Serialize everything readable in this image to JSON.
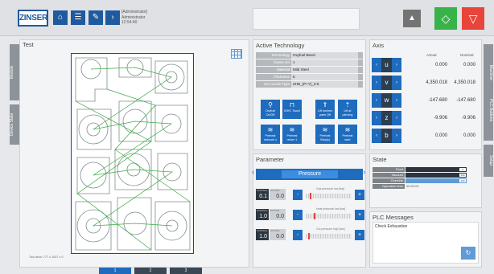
{
  "header": {
    "logo": "ZINSER",
    "user_role": "[Administrator]",
    "user_name": "Administrator",
    "time": "12:54:40",
    "icons": [
      "home-icon",
      "list-icon",
      "wrench-icon",
      "chevron-right-icon"
    ],
    "colors": {
      "accent": "#1f5a9e",
      "start": "#37b34a",
      "stop": "#e8443a"
    }
  },
  "left_tabs": [
    "Module",
    "Device State"
  ],
  "right_tabs": [
    "Machine",
    "PLC Buttons",
    "Setup"
  ],
  "test_panel": {
    "title": "Test",
    "footer": "Tool area: 777 x 1037 x 0"
  },
  "technology": {
    "title": "Active Technology",
    "rows": [
      {
        "k": "Technology",
        "v": "Oxyfuel Bevel"
      },
      {
        "k": "Gases set",
        "v": "1"
      },
      {
        "k": "Material",
        "v": "Mild Steel"
      },
      {
        "k": "Thickness",
        "v": "6"
      },
      {
        "k": "Cut nozzle Type",
        "v": "ZHD_(P+Y)_3-6"
      }
    ],
    "buttons": [
      {
        "label": "Oxyfuel\nOn/Off",
        "icon": "torch-icon"
      },
      {
        "label": "IDHC Touch",
        "icon": "sensor-icon"
      },
      {
        "label": "Lift torches\nparts Off",
        "icon": "lift-icon"
      },
      {
        "label": "Lift at\npiercing",
        "icon": "piercing-icon"
      },
      {
        "label": "Preheat\nreduced x",
        "icon": "preheat-icon"
      },
      {
        "label": "Preheat\nreturn 1",
        "icon": "preheat-icon"
      },
      {
        "label": "Preheat\nStep(s)",
        "icon": "step-icon"
      },
      {
        "label": "Preheat\nstart",
        "icon": "start-icon"
      }
    ]
  },
  "axis": {
    "title": "Axis",
    "col_actual": "Actual",
    "col_nominal": "Nominal",
    "rows": [
      {
        "name": "u",
        "actual": "0.000",
        "nominal": "0.000"
      },
      {
        "name": "v",
        "actual": "4,350.018",
        "nominal": "4,350.018"
      },
      {
        "name": "w",
        "actual": "-147.680",
        "nominal": "-147.680"
      },
      {
        "name": "z",
        "actual": "-9.906",
        "nominal": "-9.906"
      },
      {
        "name": "b",
        "actual": "0.000",
        "nominal": "0.000"
      }
    ]
  },
  "parameter": {
    "title": "Parameter",
    "current": "Pressure",
    "rows": [
      {
        "caption": "Gas pressure low",
        "nominal_label": "NOMINAL",
        "actual_label": "ACTUAL",
        "nominal": "0.1",
        "actual": "0.0",
        "unit": "[bar]"
      },
      {
        "caption": "Heat pressure low",
        "nominal_label": "NOMINAL",
        "actual_label": "ACTUAL",
        "nominal": "1.0",
        "actual": "0.0",
        "unit": "[bar]"
      },
      {
        "caption": "Cut pressure high",
        "nominal_label": "NOMINAL",
        "actual_label": "ACTUAL",
        "nominal": "1.0",
        "actual": "0.0",
        "unit": "[bar]"
      }
    ]
  },
  "state": {
    "title": "State",
    "rows": [
      {
        "label": "Feed",
        "value": "0"
      },
      {
        "label": "Vacuum",
        "value": "100"
      },
      {
        "label": "Override",
        "value": "100"
      },
      {
        "label": "Operation time",
        "value": "00:00:00"
      }
    ]
  },
  "plc": {
    "title": "PLC Messages",
    "message": "Check Exhaustion"
  },
  "pagination": [
    "1",
    "2",
    "3"
  ]
}
